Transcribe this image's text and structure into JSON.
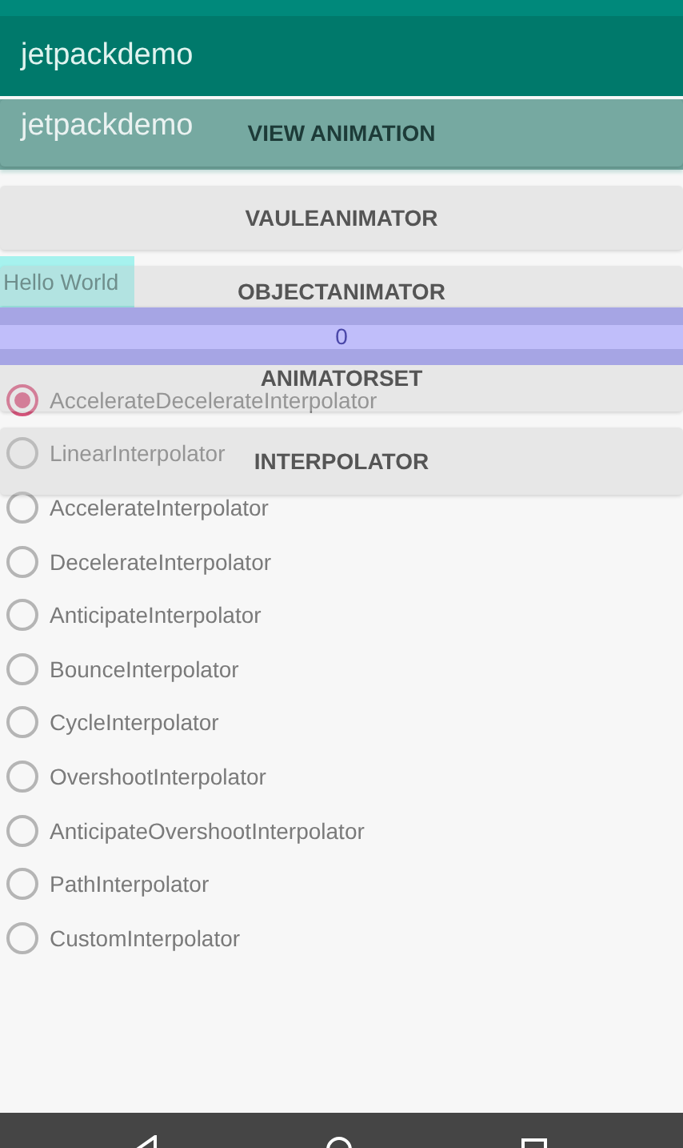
{
  "app_bar": {
    "title": "jetpackdemo"
  },
  "second_screen": {
    "app_bar": {
      "title": "jetpackdemo"
    },
    "label": "Hello World",
    "counter": "0",
    "radios": [
      {
        "label": "AccelerateDecelerateInterpolator",
        "selected": true
      },
      {
        "label": "LinearInterpolator",
        "selected": false
      },
      {
        "label": "AccelerateInterpolator",
        "selected": false
      },
      {
        "label": "DecelerateInterpolator",
        "selected": false
      },
      {
        "label": "AnticipateInterpolator",
        "selected": false
      },
      {
        "label": "BounceInterpolator",
        "selected": false
      },
      {
        "label": "CycleInterpolator",
        "selected": false
      },
      {
        "label": "OvershootInterpolator",
        "selected": false
      },
      {
        "label": "AnticipateOvershootInterpolator",
        "selected": false
      },
      {
        "label": "PathInterpolator",
        "selected": false
      },
      {
        "label": "CustomInterpolator",
        "selected": false
      }
    ]
  },
  "buttons": [
    "VIEW ANIMATION",
    "VAULEANIMATOR",
    "OBJECTANIMATOR",
    "ANIMATORSET",
    "INTERPOLATOR"
  ]
}
